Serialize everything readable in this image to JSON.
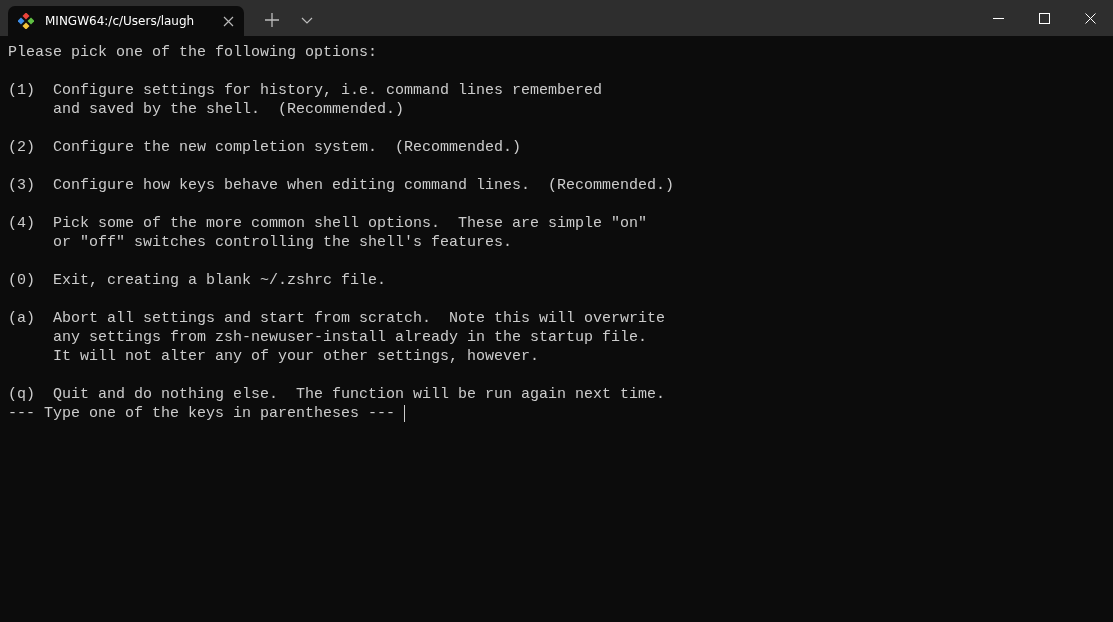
{
  "tab": {
    "title": "MINGW64:/c/Users/laugh",
    "selected": true
  },
  "terminal": {
    "intro": "Please pick one of the following options:",
    "options": [
      {
        "key": "(1)",
        "lines": [
          "Configure settings for history, i.e. command lines remembered",
          "and saved by the shell.  (Recommended.)"
        ]
      },
      {
        "key": "(2)",
        "lines": [
          "Configure the new completion system.  (Recommended.)"
        ]
      },
      {
        "key": "(3)",
        "lines": [
          "Configure how keys behave when editing command lines.  (Recommended.)"
        ]
      },
      {
        "key": "(4)",
        "lines": [
          "Pick some of the more common shell options.  These are simple \"on\"",
          "or \"off\" switches controlling the shell's features."
        ]
      },
      {
        "key": "(0)",
        "lines": [
          "Exit, creating a blank ~/.zshrc file."
        ]
      },
      {
        "key": "(a)",
        "lines": [
          "Abort all settings and start from scratch.  Note this will overwrite",
          "any settings from zsh-newuser-install already in the startup file.",
          "It will not alter any of your other settings, however."
        ]
      },
      {
        "key": "(q)",
        "lines": [
          "Quit and do nothing else.  The function will be run again next time."
        ]
      }
    ],
    "prompt": "--- Type one of the keys in parentheses ---"
  }
}
